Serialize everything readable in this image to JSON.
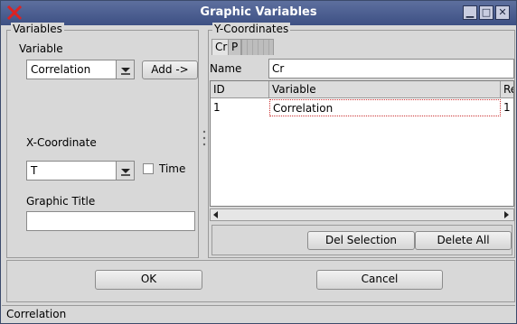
{
  "window": {
    "title": "Graphic Variables",
    "minimize_glyph": "▁",
    "maximize_glyph": "□",
    "close_glyph": "✕"
  },
  "variables": {
    "group_title": "Variables",
    "variable_label": "Variable",
    "variable_value": "Correlation",
    "add_label": "Add ->",
    "xcoord_label": "X-Coordinate",
    "xcoord_value": "T",
    "time_label": "Time",
    "graphic_title_label": "Graphic Title",
    "graphic_title_value": ""
  },
  "ycoords": {
    "group_title": "Y-Coordinates",
    "tabs": [
      "Cr",
      "P"
    ],
    "name_label": "Name",
    "name_value": "Cr",
    "table": {
      "headers": [
        "ID",
        "Variable",
        "Re"
      ],
      "rows": [
        [
          "1",
          "Correlation",
          "1"
        ]
      ]
    },
    "del_selection_label": "Del Selection",
    "delete_all_label": "Delete All"
  },
  "footer": {
    "ok_label": "OK",
    "cancel_label": "Cancel"
  },
  "status": {
    "text": "Correlation"
  }
}
